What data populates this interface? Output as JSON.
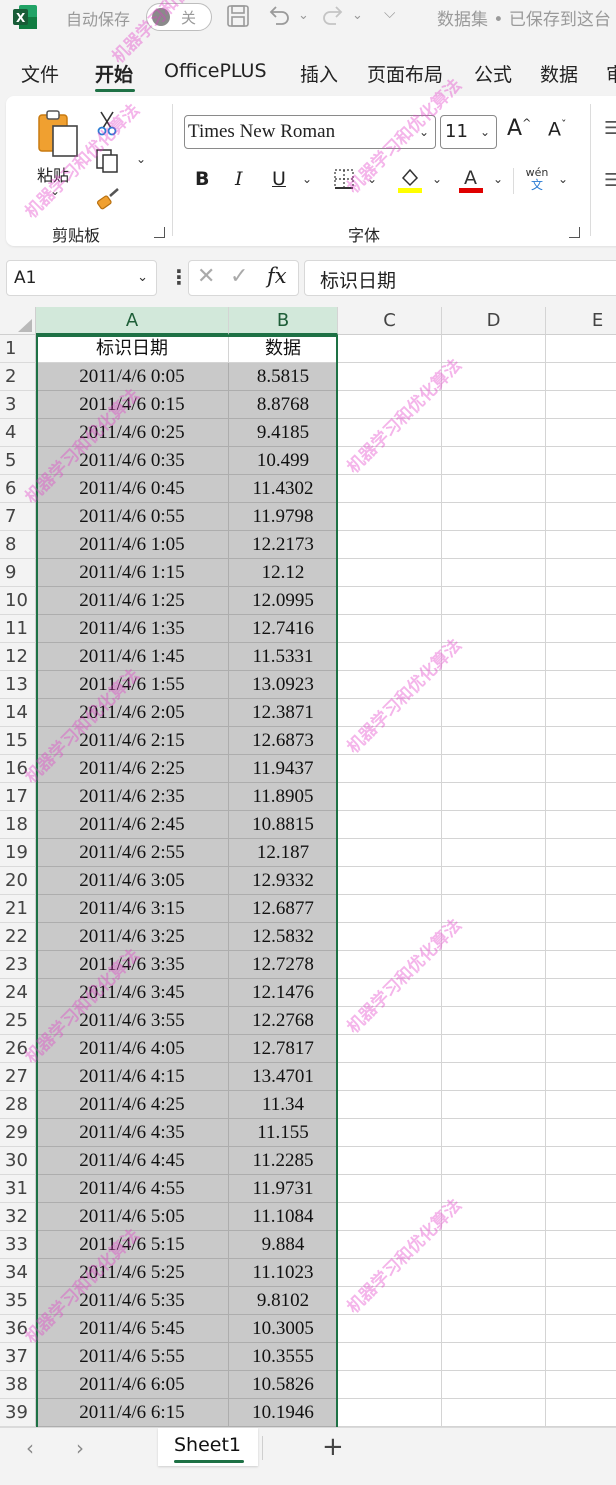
{
  "titlebar": {
    "autosave_label": "自动保存",
    "autosave_state": "关",
    "doc_title": "数据集 • 已保存到这台"
  },
  "ribbon_tabs": [
    "文件",
    "开始",
    "OfficePLUS",
    "插入",
    "页面布局",
    "公式",
    "数据",
    "审"
  ],
  "active_tab": "开始",
  "clipboard": {
    "paste_label": "粘贴",
    "group_label": "剪贴板"
  },
  "font": {
    "name": "Times New Roman",
    "size": "11",
    "group_label": "字体",
    "bold": "B",
    "italic": "I",
    "underline": "U",
    "phonetic_top": "wén",
    "phonetic_bottom": "文",
    "highlight_color": "#ffff00",
    "font_color": "#e00000"
  },
  "formula_bar": {
    "name_box": "A1",
    "content": "标识日期"
  },
  "columns": [
    "A",
    "B",
    "C",
    "D",
    "E"
  ],
  "headers": [
    "标识日期",
    "数据"
  ],
  "rows": [
    [
      "2011/4/6 0:05",
      "8.5815"
    ],
    [
      "2011/4/6 0:15",
      "8.8768"
    ],
    [
      "2011/4/6 0:25",
      "9.4185"
    ],
    [
      "2011/4/6 0:35",
      "10.499"
    ],
    [
      "2011/4/6 0:45",
      "11.4302"
    ],
    [
      "2011/4/6 0:55",
      "11.9798"
    ],
    [
      "2011/4/6 1:05",
      "12.2173"
    ],
    [
      "2011/4/6 1:15",
      "12.12"
    ],
    [
      "2011/4/6 1:25",
      "12.0995"
    ],
    [
      "2011/4/6 1:35",
      "12.7416"
    ],
    [
      "2011/4/6 1:45",
      "11.5331"
    ],
    [
      "2011/4/6 1:55",
      "13.0923"
    ],
    [
      "2011/4/6 2:05",
      "12.3871"
    ],
    [
      "2011/4/6 2:15",
      "12.6873"
    ],
    [
      "2011/4/6 2:25",
      "11.9437"
    ],
    [
      "2011/4/6 2:35",
      "11.8905"
    ],
    [
      "2011/4/6 2:45",
      "10.8815"
    ],
    [
      "2011/4/6 2:55",
      "12.187"
    ],
    [
      "2011/4/6 3:05",
      "12.9332"
    ],
    [
      "2011/4/6 3:15",
      "12.6877"
    ],
    [
      "2011/4/6 3:25",
      "12.5832"
    ],
    [
      "2011/4/6 3:35",
      "12.7278"
    ],
    [
      "2011/4/6 3:45",
      "12.1476"
    ],
    [
      "2011/4/6 3:55",
      "12.2768"
    ],
    [
      "2011/4/6 4:05",
      "12.7817"
    ],
    [
      "2011/4/6 4:15",
      "13.4701"
    ],
    [
      "2011/4/6 4:25",
      "11.34"
    ],
    [
      "2011/4/6 4:35",
      "11.155"
    ],
    [
      "2011/4/6 4:45",
      "11.2285"
    ],
    [
      "2011/4/6 4:55",
      "11.9731"
    ],
    [
      "2011/4/6 5:05",
      "11.1084"
    ],
    [
      "2011/4/6 5:15",
      "9.884"
    ],
    [
      "2011/4/6 5:25",
      "11.1023"
    ],
    [
      "2011/4/6 5:35",
      "9.8102"
    ],
    [
      "2011/4/6 5:45",
      "10.3005"
    ],
    [
      "2011/4/6 5:55",
      "10.3555"
    ],
    [
      "2011/4/6 6:05",
      "10.5826"
    ],
    [
      "2011/4/6 6:15",
      "10.1946"
    ]
  ],
  "sheet_tabs": [
    "Sheet1"
  ],
  "watermark_text": "机器学习和优化算法",
  "colors": {
    "accent": "#1e7145",
    "selected_fill": "#c9c9c9",
    "column_header_selected": "#d2e8da"
  }
}
